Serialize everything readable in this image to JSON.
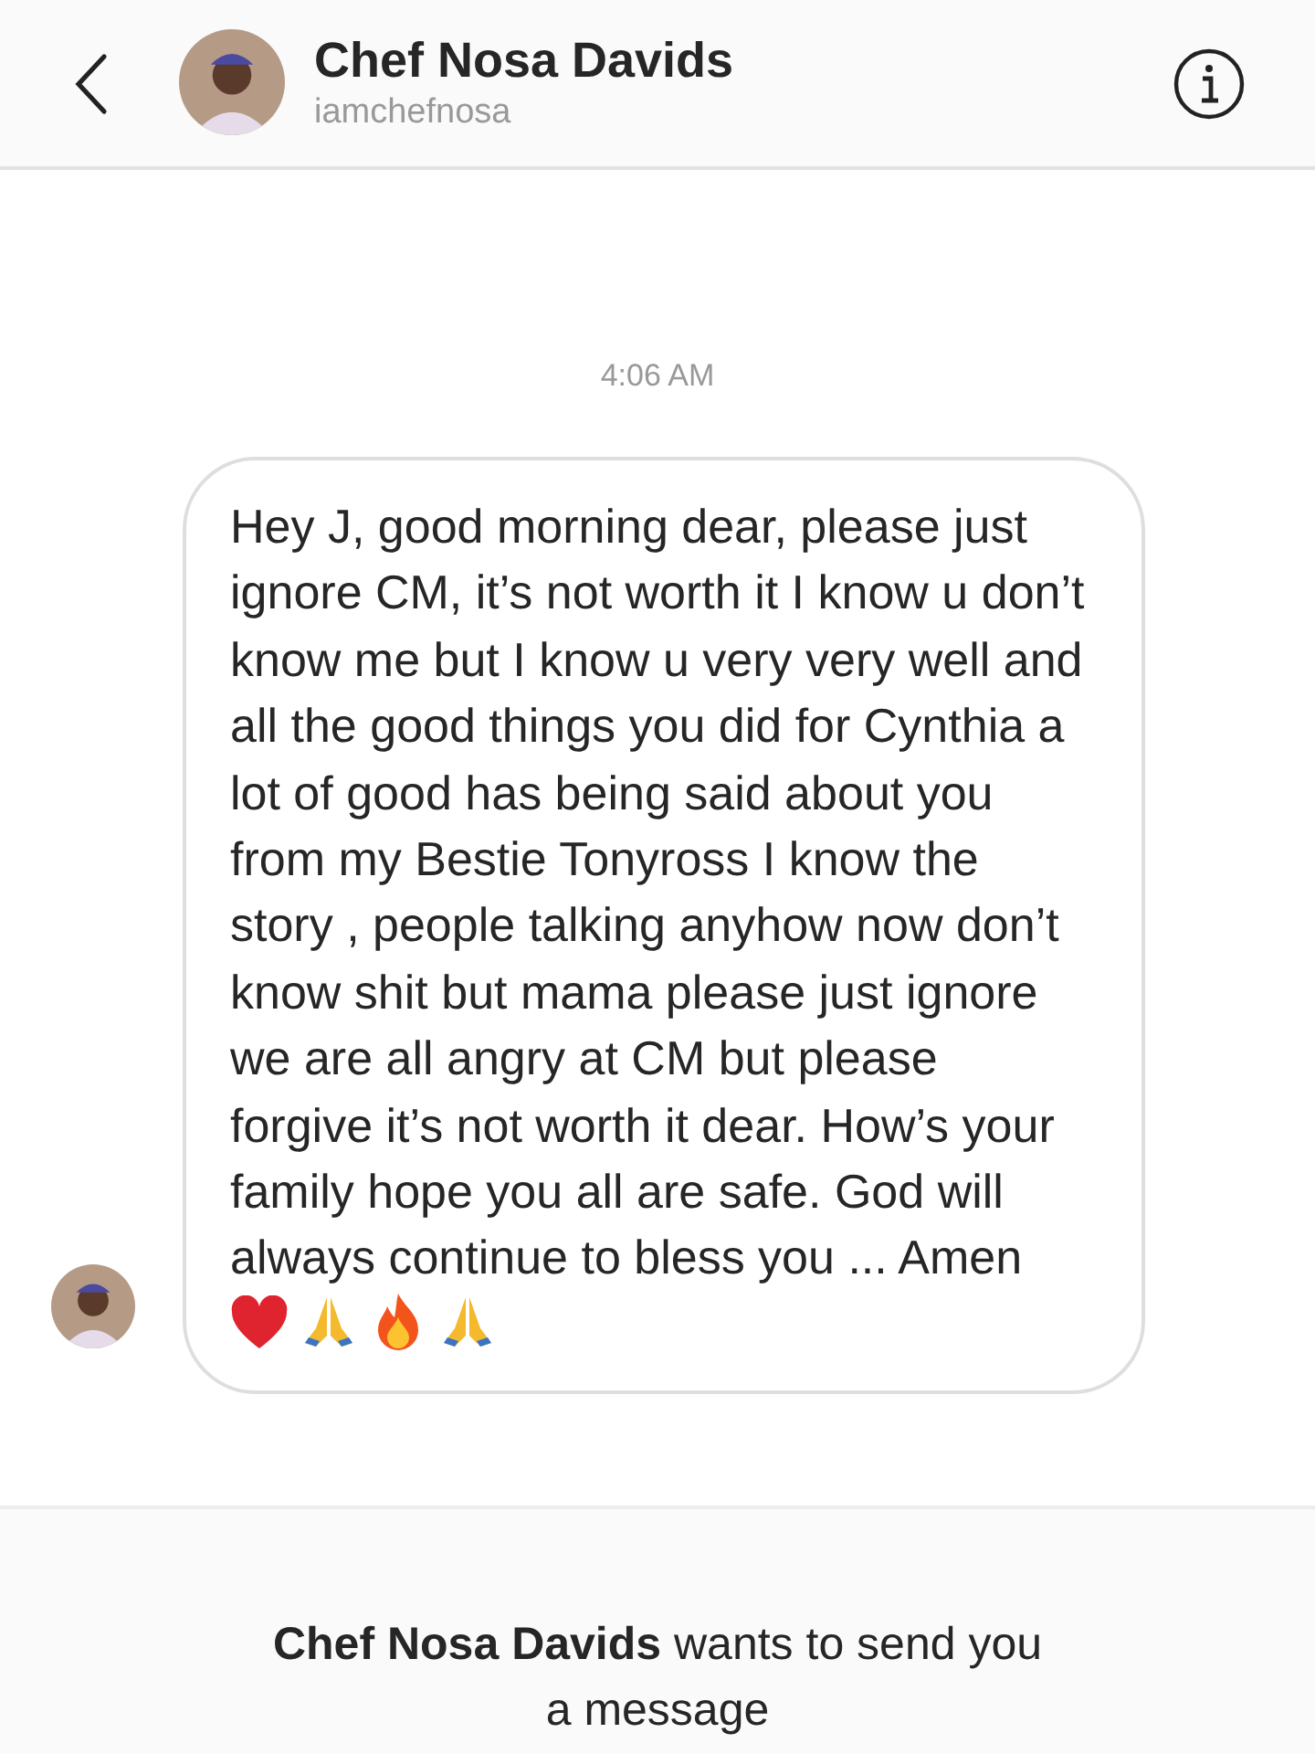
{
  "header": {
    "name": "Chef Nosa Davids",
    "username": "iamchefnosa"
  },
  "timestamp": "4:06 AM",
  "message": {
    "text": "Hey J, good morning dear, please just ignore CM, it’s not worth it I know u don’t know me but I know u very very well and all the good things you did for Cynthia a lot of good has being said about you from my Bestie Tonyross I know the story , people talking anyhow now don’t know shit but mama please just ignore we are all angry at CM but please forgive it’s not worth it dear. How’s your family hope you all are safe. God will always continue to bless you ... Amen"
  },
  "request": "**Chef Nosa Davids** wants to send you a message"
}
